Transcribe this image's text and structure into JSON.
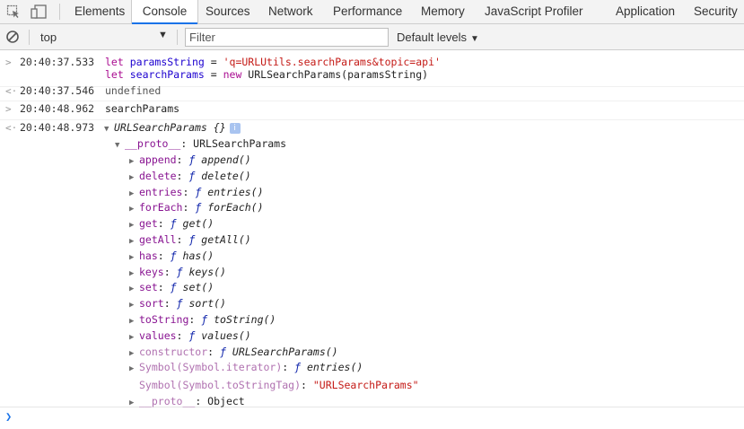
{
  "tabs": [
    "Elements",
    "Console",
    "Sources",
    "Network",
    "Performance",
    "Memory",
    "JavaScript Profiler",
    "Application",
    "Security"
  ],
  "active_tab": "Console",
  "filterbar": {
    "context": "top",
    "filter_placeholder": "Filter",
    "levels": "Default levels"
  },
  "messages": [
    {
      "type": "input",
      "timestamp": "20:40:37.533",
      "line1": {
        "kw": "let",
        "var": "paramsString",
        "eq": " = ",
        "str": "'q=URLUtils.searchParams&topic=api'"
      },
      "line2": {
        "kw": "let",
        "var": "searchParams",
        "eq": " = ",
        "kw2": "new",
        "rest": " URLSearchParams(paramsString)"
      }
    },
    {
      "type": "output",
      "timestamp": "20:40:37.546",
      "text": "undefined"
    },
    {
      "type": "input",
      "timestamp": "20:40:48.962",
      "text": "searchParams"
    },
    {
      "type": "output",
      "timestamp": "20:40:48.973",
      "text": "URLSearchParams {}",
      "info": "i"
    }
  ],
  "proto": {
    "key": "__proto__",
    "value": "URLSearchParams",
    "members": [
      {
        "key": "append",
        "fn": "append()"
      },
      {
        "key": "delete",
        "fn": "delete()"
      },
      {
        "key": "entries",
        "fn": "entries()"
      },
      {
        "key": "forEach",
        "fn": "forEach()"
      },
      {
        "key": "get",
        "fn": "get()"
      },
      {
        "key": "getAll",
        "fn": "getAll()"
      },
      {
        "key": "has",
        "fn": "has()"
      },
      {
        "key": "keys",
        "fn": "keys()"
      },
      {
        "key": "set",
        "fn": "set()"
      },
      {
        "key": "sort",
        "fn": "sort()"
      },
      {
        "key": "toString",
        "fn": "toString()"
      },
      {
        "key": "values",
        "fn": "values()"
      },
      {
        "key": "constructor",
        "fn": "URLSearchParams()"
      },
      {
        "key": "Symbol(Symbol.iterator)",
        "fn": "entries()"
      }
    ],
    "tostringtag": {
      "key": "Symbol(Symbol.toStringTag)",
      "value": "\"URLSearchParams\""
    },
    "inner_proto": {
      "key": "__proto__",
      "value": "Object"
    }
  },
  "f_glyph": "ƒ"
}
